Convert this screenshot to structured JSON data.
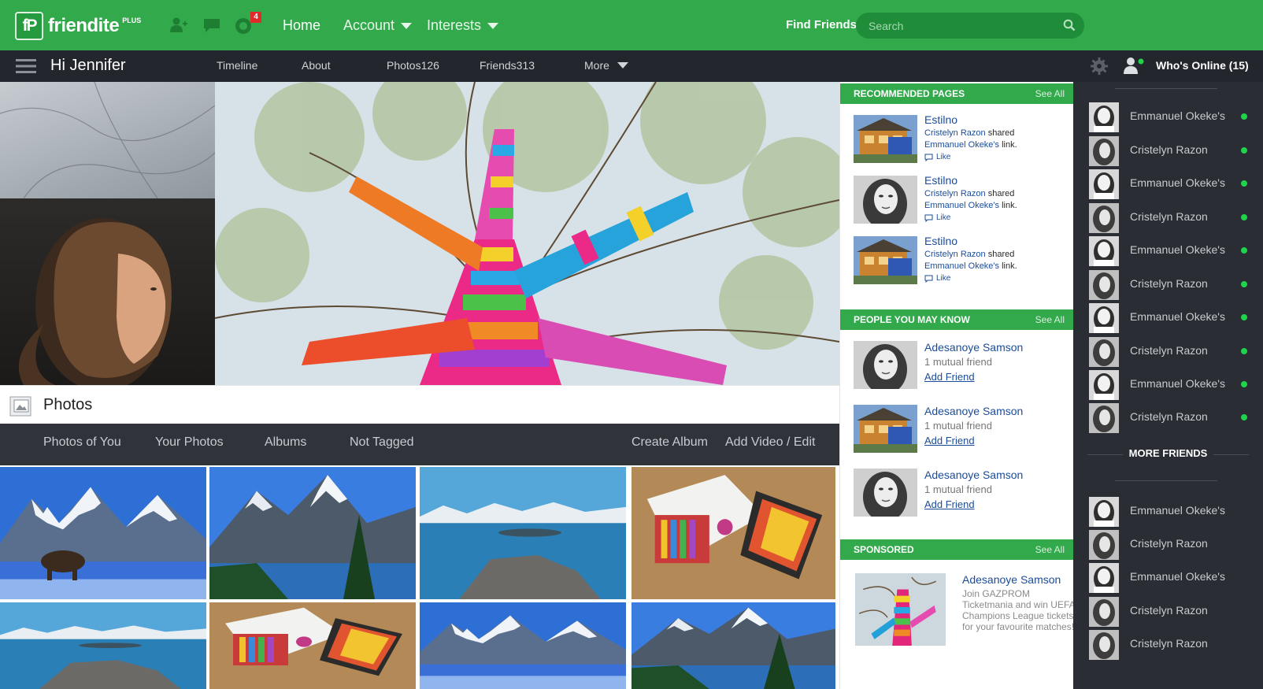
{
  "app": {
    "logo_mark": "fP",
    "logo_text": "friendite",
    "logo_plus": "PLUS",
    "notification_count": "4",
    "nav_home": "Home",
    "nav_account": "Account",
    "nav_interests": "Interests",
    "find_friends": "Find Friends",
    "search_placeholder": "Search",
    "brand_color": "#32a94b"
  },
  "subnav": {
    "greeting": "Hi Jennifer",
    "tabs": [
      "Timeline",
      "About",
      "Photos126",
      "Friends313"
    ],
    "more": "More",
    "whos_online": "Who's Online (15)"
  },
  "photos": {
    "title": "Photos",
    "tabs": [
      "Photos of You",
      "Your Photos",
      "Albums",
      "Not Tagged"
    ],
    "create_album": "Create Album",
    "add_video": "Add Video / Edit"
  },
  "recommended": {
    "title": "RECOMMENDED PAGES",
    "see_all": "See All",
    "items": [
      {
        "name": "Estilno",
        "sharer": "Cristelyn Razon",
        "shared": "shared",
        "owner": "Emmanuel Okeke's",
        "link": "link.",
        "like": "Like"
      },
      {
        "name": "Estilno",
        "sharer": "Cristelyn Razon",
        "shared": "shared",
        "owner": "Emmanuel Okeke's",
        "link": "link.",
        "like": "Like"
      },
      {
        "name": "Estilno",
        "sharer": "Cristelyn Razon",
        "shared": "shared",
        "owner": "Emmanuel Okeke's",
        "link": "link.",
        "like": "Like"
      }
    ]
  },
  "people": {
    "title": "PEOPLE YOU MAY KNOW",
    "see_all": "See All",
    "items": [
      {
        "name": "Adesanoye Samson",
        "mutual": "1 mutual friend",
        "add": "Add Friend"
      },
      {
        "name": "Adesanoye Samson",
        "mutual": "1 mutual friend",
        "add": "Add Friend"
      },
      {
        "name": "Adesanoye Samson",
        "mutual": "1 mutual friend",
        "add": "Add Friend"
      }
    ]
  },
  "sponsored": {
    "title": "SPONSORED",
    "see_all": "See All",
    "name": "Adesanoye Samson",
    "body": "Join GAZPROM Ticketmania and win UEFA Champions League tickets for your favourite matches!"
  },
  "chat": {
    "online": [
      "Emmanuel Okeke's",
      "Cristelyn Razon",
      "Emmanuel Okeke's",
      "Cristelyn Razon",
      "Emmanuel Okeke's",
      "Cristelyn Razon",
      "Emmanuel Okeke's",
      "Cristelyn Razon",
      "Emmanuel Okeke's",
      "Cristelyn Razon"
    ],
    "more_friends": "MORE FRIENDS",
    "more": [
      "Emmanuel Okeke's",
      "Cristelyn Razon",
      "Emmanuel Okeke's",
      "Cristelyn Razon",
      "Cristelyn Razon"
    ]
  }
}
